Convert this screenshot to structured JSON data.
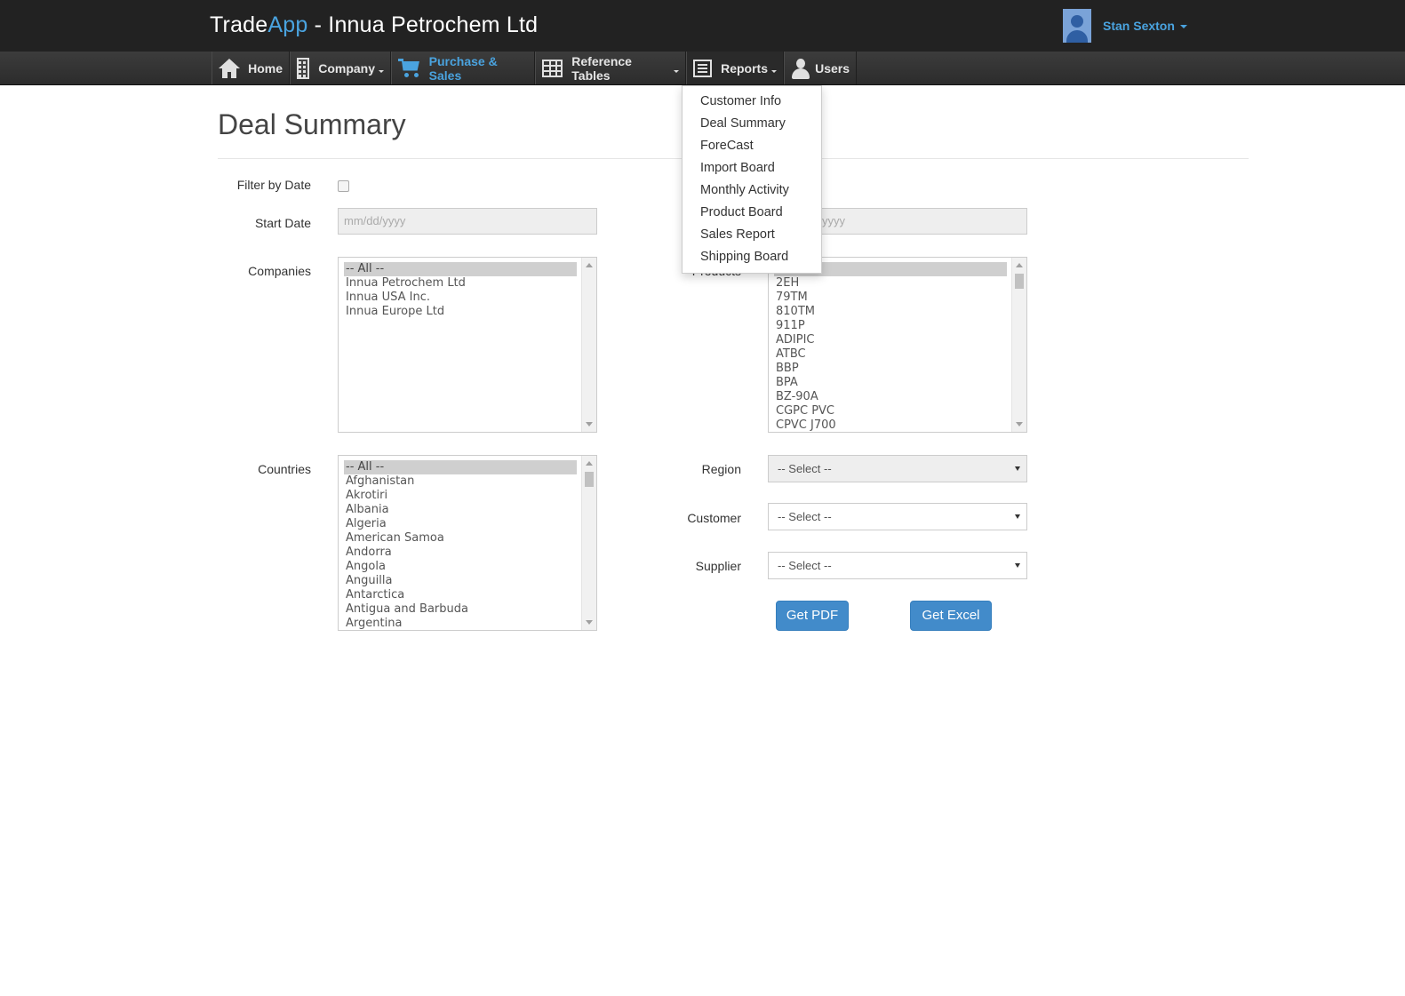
{
  "header": {
    "brand_trade": "Trade",
    "brand_app": "App",
    "brand_rest": " - Innua Petrochem Ltd",
    "user_name": "Stan Sexton"
  },
  "nav": {
    "home": "Home",
    "company": "Company",
    "purchase_sales": "Purchase & Sales",
    "reference_tables": "Reference Tables",
    "reports": "Reports",
    "users": "Users",
    "active": "Purchase & Sales"
  },
  "reports_menu": {
    "items": [
      "Customer Info",
      "Deal Summary",
      "ForeCast",
      "Import Board",
      "Monthly Activity",
      "Product Board",
      "Sales Report",
      "Shipping Board"
    ]
  },
  "page": {
    "title": "Deal Summary"
  },
  "form": {
    "filter_by_date_label": "Filter by Date",
    "filter_by_date_checked": false,
    "start_date_label": "Start Date",
    "start_date_placeholder": "mm/dd/yyyy",
    "end_date_placeholder_visible": "yyyy",
    "companies_label": "Companies",
    "companies": [
      "-- All --",
      "Innua Petrochem Ltd",
      "Innua USA Inc.",
      "Innua Europe Ltd"
    ],
    "products_label": "Products",
    "products": [
      "-- All --",
      "2EH",
      "79TM",
      "810TM",
      "911P",
      "ADIPIC",
      "ATBC",
      "BBP",
      "BPA",
      "BZ-90A",
      "CGPC PVC",
      "CPVC J700"
    ],
    "countries_label": "Countries",
    "countries": [
      "-- All --",
      "Afghanistan",
      "Akrotiri",
      "Albania",
      "Algeria",
      "American Samoa",
      "Andorra",
      "Angola",
      "Anguilla",
      "Antarctica",
      "Antigua and Barbuda",
      "Argentina"
    ],
    "region_label": "Region",
    "region_value": "-- Select --",
    "customer_label": "Customer",
    "customer_value": "-- Select --",
    "supplier_label": "Supplier",
    "supplier_value": "-- Select --",
    "get_pdf": "Get PDF",
    "get_excel": "Get Excel"
  },
  "colors": {
    "topbar": "#222222",
    "accent": "#4aa3df",
    "button": "#428bca"
  },
  "icons": {
    "home": "home-icon",
    "company": "building-icon",
    "purchase_sales": "cart-icon",
    "reference_tables": "table-grid-icon",
    "reports": "report-list-icon",
    "users": "user-icon"
  }
}
